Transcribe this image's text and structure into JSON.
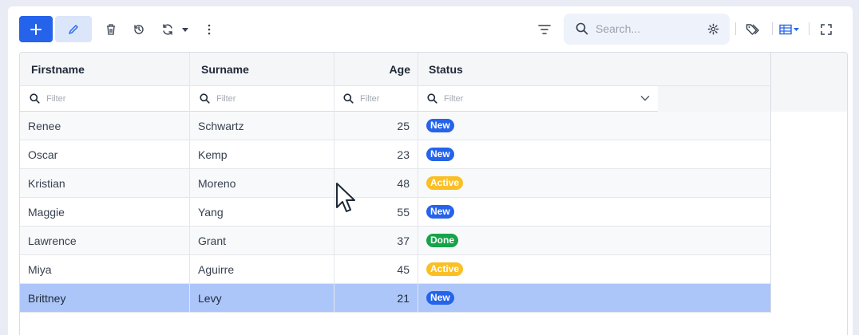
{
  "toolbar": {
    "add_icon": "plus-icon",
    "edit_icon": "pencil-icon",
    "delete_icon": "trash-icon",
    "history_icon": "history-icon",
    "refresh_icon": "refresh-icon",
    "refresh_menu_icon": "caret-down-icon",
    "more_icon": "more-vertical-icon",
    "filter_icon": "filter-lines-icon",
    "search_placeholder": "Search...",
    "search_settings_icon": "gear-icon",
    "tag_icon": "tag-icon",
    "columns_icon": "table-columns-icon",
    "fullscreen_icon": "fullscreen-icon"
  },
  "grid": {
    "columns": [
      {
        "key": "firstname",
        "label": "Firstname",
        "align": "left"
      },
      {
        "key": "surname",
        "label": "Surname",
        "align": "left"
      },
      {
        "key": "age",
        "label": "Age",
        "align": "right"
      },
      {
        "key": "status",
        "label": "Status",
        "align": "left"
      }
    ],
    "filter_placeholder": "Filter",
    "rows": [
      {
        "firstname": "Renee",
        "surname": "Schwartz",
        "age": "25",
        "status": "New"
      },
      {
        "firstname": "Oscar",
        "surname": "Kemp",
        "age": "23",
        "status": "New"
      },
      {
        "firstname": "Kristian",
        "surname": "Moreno",
        "age": "48",
        "status": "Active"
      },
      {
        "firstname": "Maggie",
        "surname": "Yang",
        "age": "55",
        "status": "New"
      },
      {
        "firstname": "Lawrence",
        "surname": "Grant",
        "age": "37",
        "status": "Done"
      },
      {
        "firstname": "Miya",
        "surname": "Aguirre",
        "age": "45",
        "status": "Active"
      },
      {
        "firstname": "Brittney",
        "surname": "Levy",
        "age": "21",
        "status": "New",
        "selected": true
      }
    ]
  },
  "status_colors": {
    "New": "#2563eb",
    "Active": "#fbbf24",
    "Done": "#16a34a"
  },
  "colors": {
    "accent": "#2563eb",
    "selected_row": "#adc6fa"
  }
}
